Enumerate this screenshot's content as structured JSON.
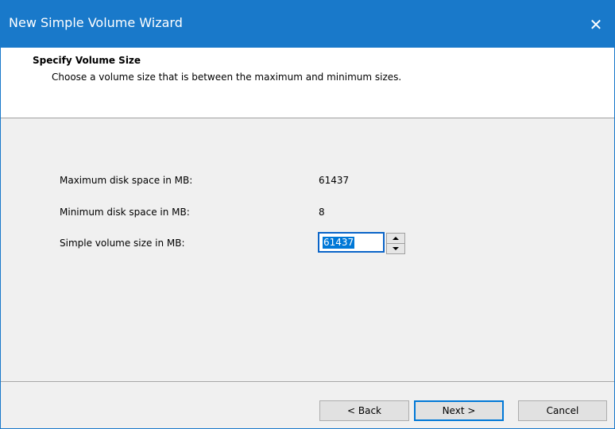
{
  "window": {
    "title": "New Simple Volume Wizard",
    "close_glyph": "✕"
  },
  "header": {
    "title": "Specify Volume Size",
    "subtitle": "Choose a volume size that is between the maximum and minimum sizes."
  },
  "fields": {
    "max_label": "Maximum disk space in MB:",
    "max_value": "61437",
    "min_label": "Minimum disk space in MB:",
    "min_value": "8",
    "size_label": "Simple volume size in MB:",
    "size_value": "61437"
  },
  "buttons": {
    "back": "< Back",
    "next": "Next >",
    "cancel": "Cancel"
  },
  "colors": {
    "titlebar": "#1979ca",
    "selection": "#0078d7"
  }
}
